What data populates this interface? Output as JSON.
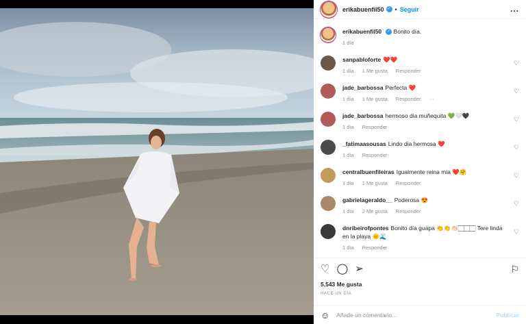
{
  "header": {
    "username": "erikabuenfil50",
    "dot": "•",
    "follow_label": "Seguir",
    "more_label": "..."
  },
  "caption": {
    "username": "erikabuenfil50",
    "text": "Bonito día.",
    "time": "1 día"
  },
  "comments": [
    {
      "username": "sanpabloforte",
      "text": "❤️❤️",
      "time": "1 día",
      "likes": "1 Me gusta",
      "reply": "Responder",
      "avatar_color": "#6b5a4a"
    },
    {
      "username": "jade_barbossa",
      "text": "Perfecta ❤️",
      "time": "1 día",
      "likes": "1 Me gusta",
      "reply": "Responder",
      "extra": "···",
      "avatar_color": "#b25a5a"
    },
    {
      "username": "jade_barbossa",
      "text": "hermoso dia muñequita 💚🤍🖤",
      "time": "1 día",
      "likes": "",
      "reply": "Responder",
      "avatar_color": "#b25a5a"
    },
    {
      "username": "_fatimaasousas",
      "text": "Lindo dia hermosa ❤️",
      "time": "1 día",
      "likes": "",
      "reply": "Responder",
      "avatar_color": "#4a4a4a"
    },
    {
      "username": "centralbuenfileiras",
      "text": "Igualmente reina mia ❤️🤗",
      "time": "1 día",
      "likes": "1 Me gusta",
      "reply": "Responder",
      "avatar_color": "#c49a5a"
    },
    {
      "username": "gabrielageraldo__",
      "text": "Poderosa 😍",
      "time": "1 día",
      "likes": "2 Me gusta",
      "reply": "Responder",
      "avatar_color": "#a88a6a"
    },
    {
      "username": "dnribeirofpontes",
      "text": "Bonito día guapa 👏👏👏🏻🏻🏻🏻 Tere linda en la playa 🌞🌊",
      "time": "1 día",
      "likes": "",
      "reply": "Responder",
      "avatar_color": "#3a3a3a"
    }
  ],
  "actions": {
    "like_icon": "heart-outline-icon",
    "comment_icon": "comment-icon",
    "share_icon": "share-icon",
    "save_icon": "bookmark-icon",
    "likes": "5,543 Me gusta",
    "posted": "HACE UN DÍA"
  },
  "composer": {
    "placeholder": "Añade un comentario...",
    "publish_label": "Publicar"
  },
  "colors": {
    "accent": "#0095f6",
    "verified": "#3897f0",
    "publish_disabled": "#b2dffc"
  }
}
